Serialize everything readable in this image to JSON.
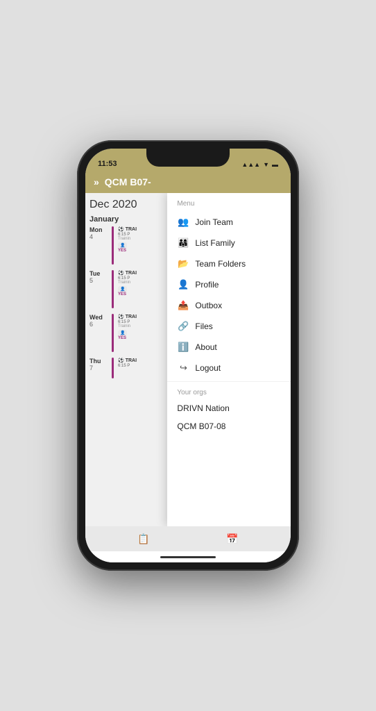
{
  "statusBar": {
    "time": "11:53",
    "signal": "▲▲▲",
    "wifi": "▼",
    "battery": "▬"
  },
  "appHeader": {
    "logo": "»",
    "title": "QCM B07-"
  },
  "calendar": {
    "month": "Dec 2020",
    "sectionLabel": "January",
    "days": [
      {
        "name": "Mon",
        "num": "4",
        "eventTitle": "TRAI",
        "eventTime": "6:15 P",
        "eventSub": "Trainin",
        "badge": "YES"
      },
      {
        "name": "Tue",
        "num": "5",
        "eventTitle": "TRAI",
        "eventTime": "6:15 P",
        "eventSub": "Trainin",
        "badge": "YES"
      },
      {
        "name": "Wed",
        "num": "6",
        "eventTitle": "TRAI",
        "eventTime": "6:15 P",
        "eventSub": "Trainin",
        "badge": "YES"
      },
      {
        "name": "Thu",
        "num": "7",
        "eventTitle": "TRAI",
        "eventTime": "6:15 P",
        "eventSub": "",
        "badge": ""
      }
    ]
  },
  "menu": {
    "sectionLabel": "Menu",
    "items": [
      {
        "id": "join-team",
        "icon": "👥",
        "label": "Join Team"
      },
      {
        "id": "list-family",
        "icon": "👨‍👩‍👧",
        "label": "List Family"
      },
      {
        "id": "team-folders",
        "icon": "📂",
        "label": "Team Folders"
      },
      {
        "id": "profile",
        "icon": "👤",
        "label": "Profile"
      },
      {
        "id": "outbox",
        "icon": "📤",
        "label": "Outbox"
      },
      {
        "id": "files",
        "icon": "🔗",
        "label": "Files"
      },
      {
        "id": "about",
        "icon": "ℹ️",
        "label": "About"
      },
      {
        "id": "logout",
        "icon": "↪",
        "label": "Logout"
      }
    ],
    "orgsLabel": "Your orgs",
    "orgs": [
      {
        "id": "drivn",
        "label": "DRIVN Nation"
      },
      {
        "id": "qcm",
        "label": "QCM B07-08"
      }
    ]
  },
  "bottomBar": {
    "icon1": "📋",
    "icon2": "📅"
  }
}
